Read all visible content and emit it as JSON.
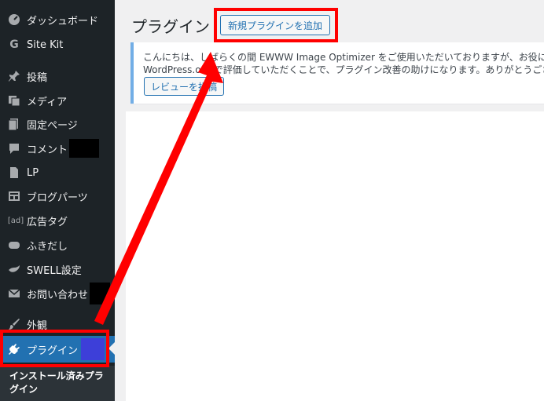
{
  "sidebar": {
    "items": [
      {
        "label": "ダッシュボード",
        "icon": "dashboard-icon"
      },
      {
        "label": "Site Kit",
        "icon": "google-g-icon"
      },
      {
        "label": "投稿",
        "icon": "pin-icon"
      },
      {
        "label": "メディア",
        "icon": "media-icon"
      },
      {
        "label": "固定ページ",
        "icon": "page-icon"
      },
      {
        "label": "コメント",
        "icon": "comment-icon"
      },
      {
        "label": "LP",
        "icon": "document-icon"
      },
      {
        "label": "ブログパーツ",
        "icon": "blog-parts-icon"
      },
      {
        "label": "広告タグ",
        "icon": "ad-icon",
        "icon_text": "[ad]"
      },
      {
        "label": "ふきだし",
        "icon": "speech-bubble-icon"
      },
      {
        "label": "SWELL設定",
        "icon": "bird-icon"
      },
      {
        "label": "お問い合わせ",
        "icon": "mail-icon"
      },
      {
        "label": "外観",
        "icon": "brush-icon"
      },
      {
        "label": "プラグイン",
        "icon": "plugin-icon"
      }
    ],
    "submenu_label": "インストール済みプラグイン"
  },
  "main": {
    "page_title": "プラグイン",
    "add_button": "新規プラグインを追加",
    "notice": {
      "line1": "こんにちは、しばらくの間 EWWW Image Optimizer をご使用いただいておりますが、お役に立て",
      "line2": "WordPress.org で評価していただくことで、プラグイン改善の助けになります。ありがとうござい",
      "review_button": "レビューを投稿"
    }
  },
  "colors": {
    "sidebar_bg": "#1d2327",
    "active_bg": "#2271b1",
    "annotation_red": "#ff0000",
    "notice_border": "#72aee6"
  }
}
